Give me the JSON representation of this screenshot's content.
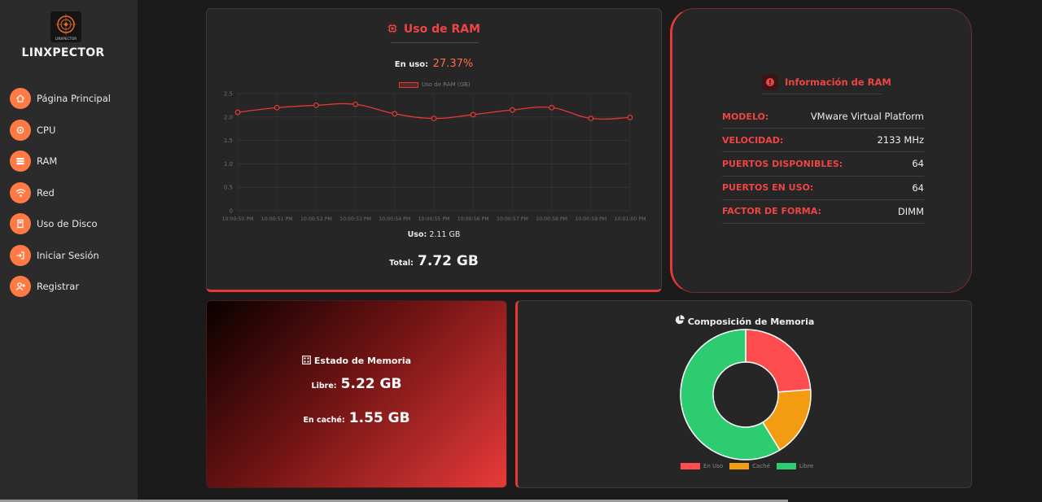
{
  "sidebar": {
    "brand": "LINXPECTOR",
    "logo_text": "LINXPECTOR",
    "items": [
      {
        "label": "Página Principal",
        "icon": "home-icon"
      },
      {
        "label": "CPU",
        "icon": "cpu-icon"
      },
      {
        "label": "RAM",
        "icon": "ram-icon"
      },
      {
        "label": "Red",
        "icon": "wifi-icon"
      },
      {
        "label": "Uso de Disco",
        "icon": "disk-icon"
      },
      {
        "label": "Iniciar Sesión",
        "icon": "login-icon"
      },
      {
        "label": "Registrar",
        "icon": "add-user-icon"
      }
    ],
    "accent": "#ff7a45"
  },
  "ram_usage": {
    "title": "Uso de RAM",
    "in_use_label": "En uso:",
    "in_use_value": "27.37%",
    "usage_label": "Uso:",
    "usage_value": "2.11 GB",
    "total_label": "Total:",
    "total_value": "7.72 GB"
  },
  "chart_data": {
    "type": "line",
    "x": [
      "10:00:50 PM",
      "10:00:51 PM",
      "10:00:52 PM",
      "10:00:53 PM",
      "10:00:54 PM",
      "10:00:55 PM",
      "10:00:56 PM",
      "10:00:57 PM",
      "10:00:58 PM",
      "10:00:59 PM",
      "10:01:00 PM"
    ],
    "series": [
      {
        "name": "Uso de RAM (GB)",
        "values": [
          2.1,
          2.2,
          2.25,
          2.27,
          2.07,
          1.97,
          2.05,
          2.15,
          2.2,
          1.97,
          1.99
        ],
        "color": "#e53935"
      }
    ],
    "yticks": [
      "0",
      "0.5",
      "1.0",
      "1.5",
      "2.0",
      "2.5"
    ],
    "ylim": [
      0,
      2.5
    ],
    "grid": true,
    "legend": "top"
  },
  "ram_info": {
    "title": "Información de RAM",
    "rows": [
      {
        "key": "MODELO:",
        "value": "VMware Virtual Platform"
      },
      {
        "key": "VELOCIDAD:",
        "value": "2133 MHz"
      },
      {
        "key": "PUERTOS DISPONIBLES:",
        "value": "64"
      },
      {
        "key": "PUERTOS EN USO:",
        "value": "64"
      },
      {
        "key": "FACTOR DE FORMA:",
        "value": "DIMM"
      }
    ]
  },
  "memory_state": {
    "title": "Estado de Memoria",
    "free_label": "Libre:",
    "free_value": "5.22 GB",
    "cached_label": "En caché:",
    "cached_value": "1.55 GB"
  },
  "composition": {
    "title": "Composición de Memoria",
    "chart_data": {
      "type": "pie",
      "categories": [
        "En Uso",
        "Caché",
        "Libre"
      ],
      "values": [
        2.11,
        1.55,
        5.22
      ],
      "colors": [
        "#ff4d4f",
        "#f39c12",
        "#2ecc71"
      ],
      "legend": "bottom"
    }
  }
}
